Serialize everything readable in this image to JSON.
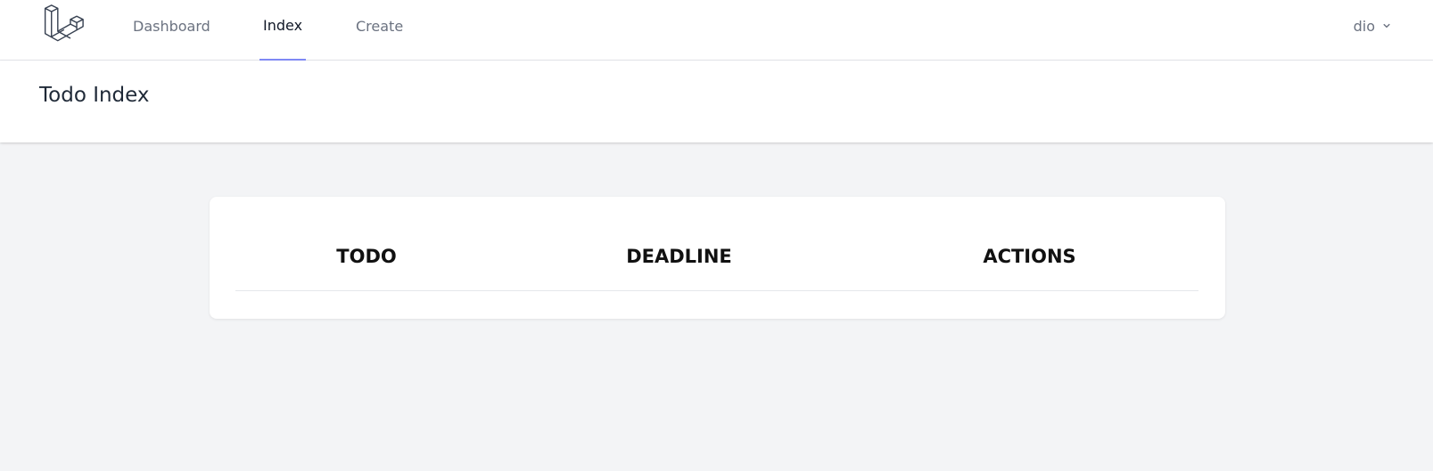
{
  "nav": {
    "logo_icon": "laravel-logo-icon",
    "links": [
      {
        "label": "Dashboard",
        "active": false
      },
      {
        "label": "Index",
        "active": true
      },
      {
        "label": "Create",
        "active": false
      }
    ],
    "active_underline_color": "#818cf8"
  },
  "user_menu": {
    "name": "dio",
    "icon": "chevron-down-icon"
  },
  "header": {
    "title": "Todo Index"
  },
  "table": {
    "columns": [
      "TODO",
      "DEADLINE",
      "ACTIONS"
    ],
    "rows": []
  }
}
